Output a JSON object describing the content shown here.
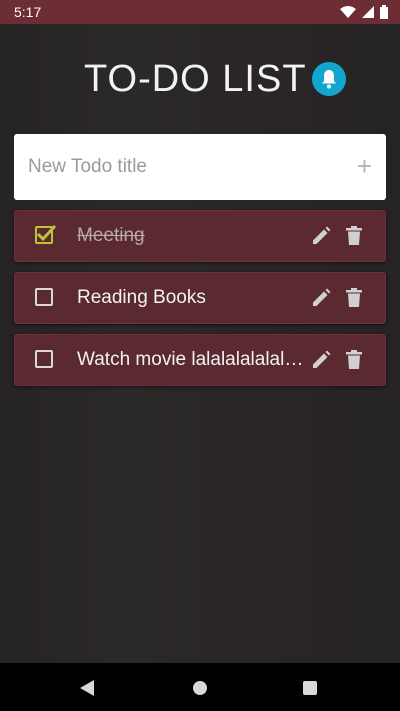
{
  "status_bar": {
    "time": "5:17",
    "icons": [
      "wifi-icon",
      "signal-icon",
      "battery-icon"
    ]
  },
  "header": {
    "title": "TO-DO LIST",
    "bell_icon": "bell-icon",
    "bell_color": "#12a6cf"
  },
  "new_todo": {
    "placeholder": "New Todo title",
    "value": "",
    "add_label": "+"
  },
  "todos": [
    {
      "label": "Meeting",
      "done": true
    },
    {
      "label": "Reading Books",
      "done": false
    },
    {
      "label": "Watch movie lalalalalalalalala",
      "done": false
    }
  ],
  "colors": {
    "status_bar": "#6d2d34",
    "todo_card": "#5a2a30",
    "check_accent": "#b8c43a",
    "background": "#2a2727"
  },
  "nav_bar": {
    "icons": [
      "back-icon",
      "home-icon",
      "recents-icon"
    ]
  }
}
